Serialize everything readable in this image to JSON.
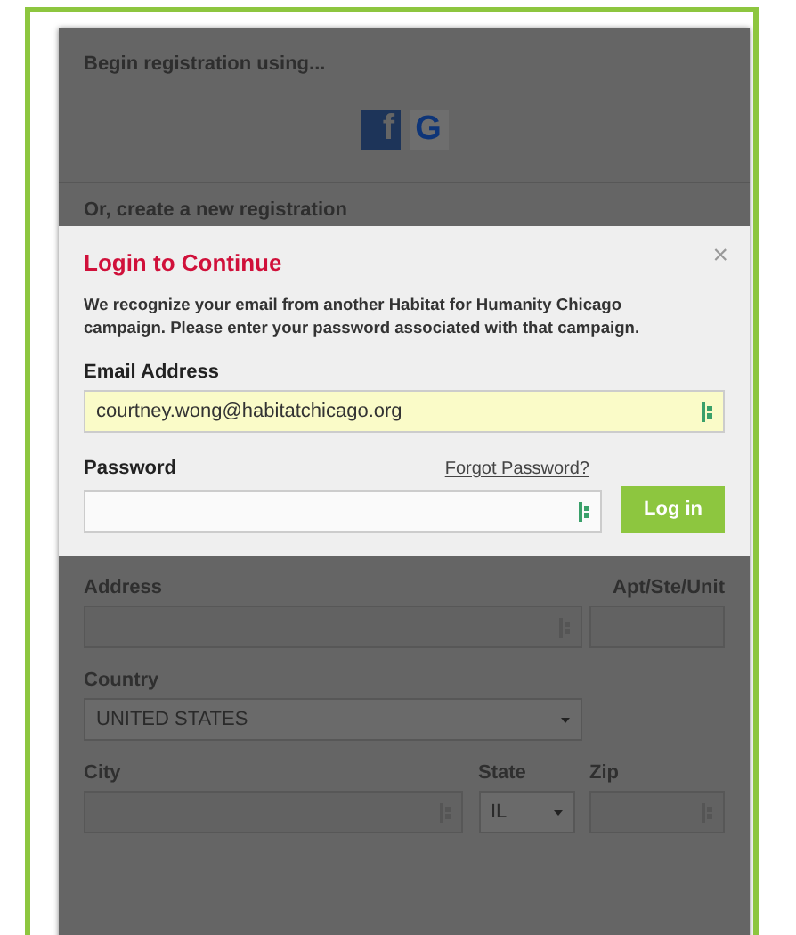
{
  "social_login": {
    "heading": "Begin registration using...",
    "providers": [
      {
        "kind": "facebook",
        "glyph": "f"
      },
      {
        "kind": "google",
        "glyph": "G"
      }
    ]
  },
  "new_registration": {
    "heading": "Or, create a new registration"
  },
  "login_modal": {
    "title": "Login to Continue",
    "close": "×",
    "message": "We recognize your email from another Habitat for Humanity Chicago campaign. Please enter your password associated with that campaign.",
    "email_label": "Email Address",
    "email_value": "courtney.wong@habitatchicago.org",
    "password_label": "Password",
    "forgot_link": "Forgot Password?",
    "login_button": "Log in"
  },
  "form": {
    "address_label": "Address",
    "apt_label": "Apt/Ste/Unit",
    "country_label": "Country",
    "country_value": "UNITED STATES",
    "city_label": "City",
    "state_label": "State",
    "state_value": "IL",
    "zip_label": "Zip"
  }
}
